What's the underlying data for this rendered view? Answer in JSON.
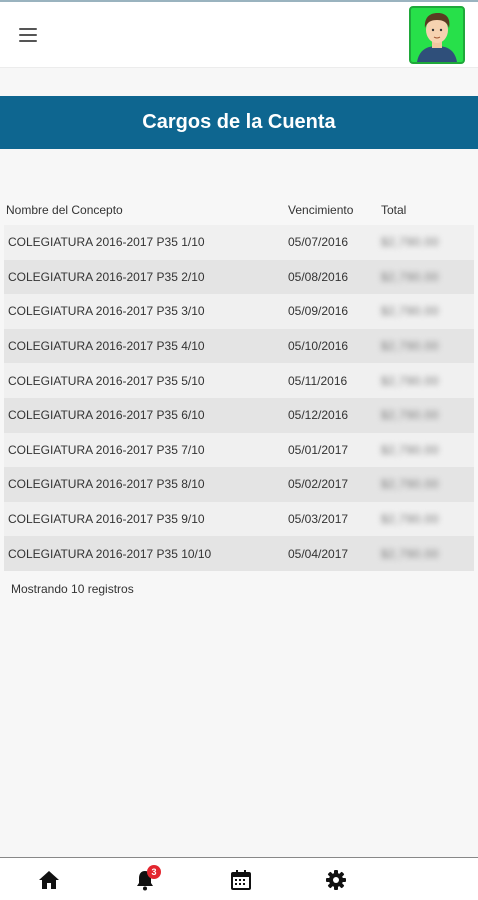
{
  "header": {
    "menu_icon": "hamburger-menu-icon",
    "avatar_icon": "user-avatar-icon",
    "avatar_bg": "#27e04a"
  },
  "page": {
    "title": "Cargos de la Cuenta",
    "title_bg": "#0e6690"
  },
  "table": {
    "columns": [
      "Nombre del Concepto",
      "Vencimiento",
      "Total"
    ],
    "rows": [
      {
        "concept": "COLEGIATURA 2016-2017 P35 1/10",
        "due": "05/07/2016",
        "total": "$2,790.00"
      },
      {
        "concept": "COLEGIATURA 2016-2017 P35 2/10",
        "due": "05/08/2016",
        "total": "$2,790.00"
      },
      {
        "concept": "COLEGIATURA 2016-2017 P35 3/10",
        "due": "05/09/2016",
        "total": "$2,790.00"
      },
      {
        "concept": "COLEGIATURA 2016-2017 P35 4/10",
        "due": "05/10/2016",
        "total": "$2,790.00"
      },
      {
        "concept": "COLEGIATURA 2016-2017 P35 5/10",
        "due": "05/11/2016",
        "total": "$2,790.00"
      },
      {
        "concept": "COLEGIATURA 2016-2017 P35 6/10",
        "due": "05/12/2016",
        "total": "$2,790.00"
      },
      {
        "concept": "COLEGIATURA 2016-2017 P35 7/10",
        "due": "05/01/2017",
        "total": "$2,790.00"
      },
      {
        "concept": "COLEGIATURA 2016-2017 P35 8/10",
        "due": "05/02/2017",
        "total": "$2,790.00"
      },
      {
        "concept": "COLEGIATURA 2016-2017 P35 9/10",
        "due": "05/03/2017",
        "total": "$2,790.00"
      },
      {
        "concept": "COLEGIATURA 2016-2017 P35 10/10",
        "due": "05/04/2017",
        "total": "$2,790.00"
      }
    ],
    "footer": "Mostrando 10 registros"
  },
  "bottom_nav": {
    "items": [
      {
        "icon": "home-icon"
      },
      {
        "icon": "bell-icon",
        "badge": "3"
      },
      {
        "icon": "calendar-icon"
      },
      {
        "icon": "gear-icon"
      }
    ]
  }
}
